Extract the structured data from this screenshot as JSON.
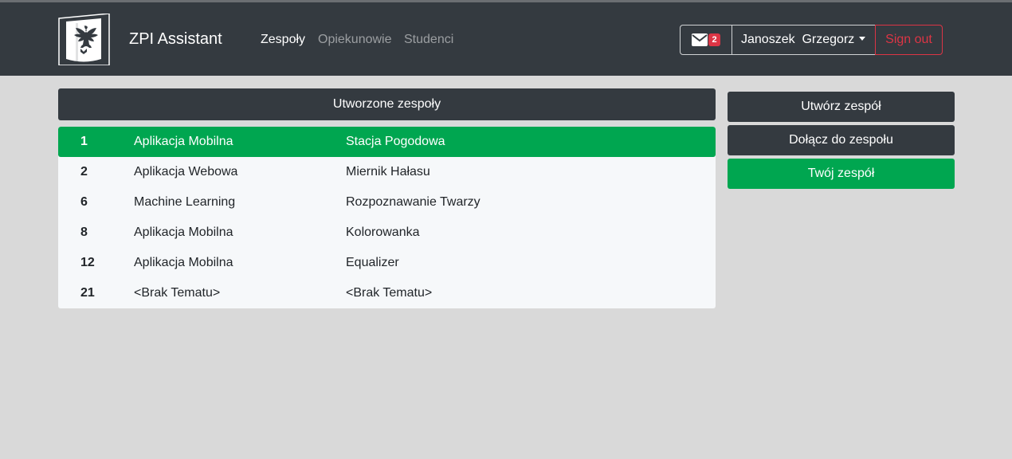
{
  "brand": {
    "title": "ZPI Assistant",
    "logo_icon": "eagle-crest-icon"
  },
  "nav": {
    "items": [
      {
        "label": "Zespoły",
        "active": true
      },
      {
        "label": "Opiekunowie",
        "active": false
      },
      {
        "label": "Studenci",
        "active": false
      }
    ]
  },
  "messages": {
    "icon": "envelope-icon",
    "count": "2"
  },
  "user": {
    "name": "Janoszek  Grzegorz"
  },
  "signout": {
    "label": "Sign out"
  },
  "teams": {
    "header": "Utworzone zespoły",
    "rows": [
      {
        "id": "1",
        "category": "Aplikacja Mobilna",
        "topic": "Stacja Pogodowa",
        "selected": true
      },
      {
        "id": "2",
        "category": "Aplikacja Webowa",
        "topic": "Miernik Hałasu",
        "selected": false
      },
      {
        "id": "6",
        "category": "Machine Learning",
        "topic": "Rozpoznawanie Twarzy",
        "selected": false
      },
      {
        "id": "8",
        "category": "Aplikacja Mobilna",
        "topic": "Kolorowanka",
        "selected": false
      },
      {
        "id": "12",
        "category": "Aplikacja Mobilna",
        "topic": "Equalizer",
        "selected": false
      },
      {
        "id": "21",
        "category": "<Brak Tematu>",
        "topic": "<Brak Tematu>",
        "selected": false
      }
    ]
  },
  "actions": {
    "create": "Utwórz zespół",
    "join": "Dołącz do zespołu",
    "yours": "Twój zespół"
  },
  "colors": {
    "navbar": "#343a40",
    "accent_green": "#00a650",
    "danger": "#dc3545",
    "background": "#d9d9d9"
  }
}
